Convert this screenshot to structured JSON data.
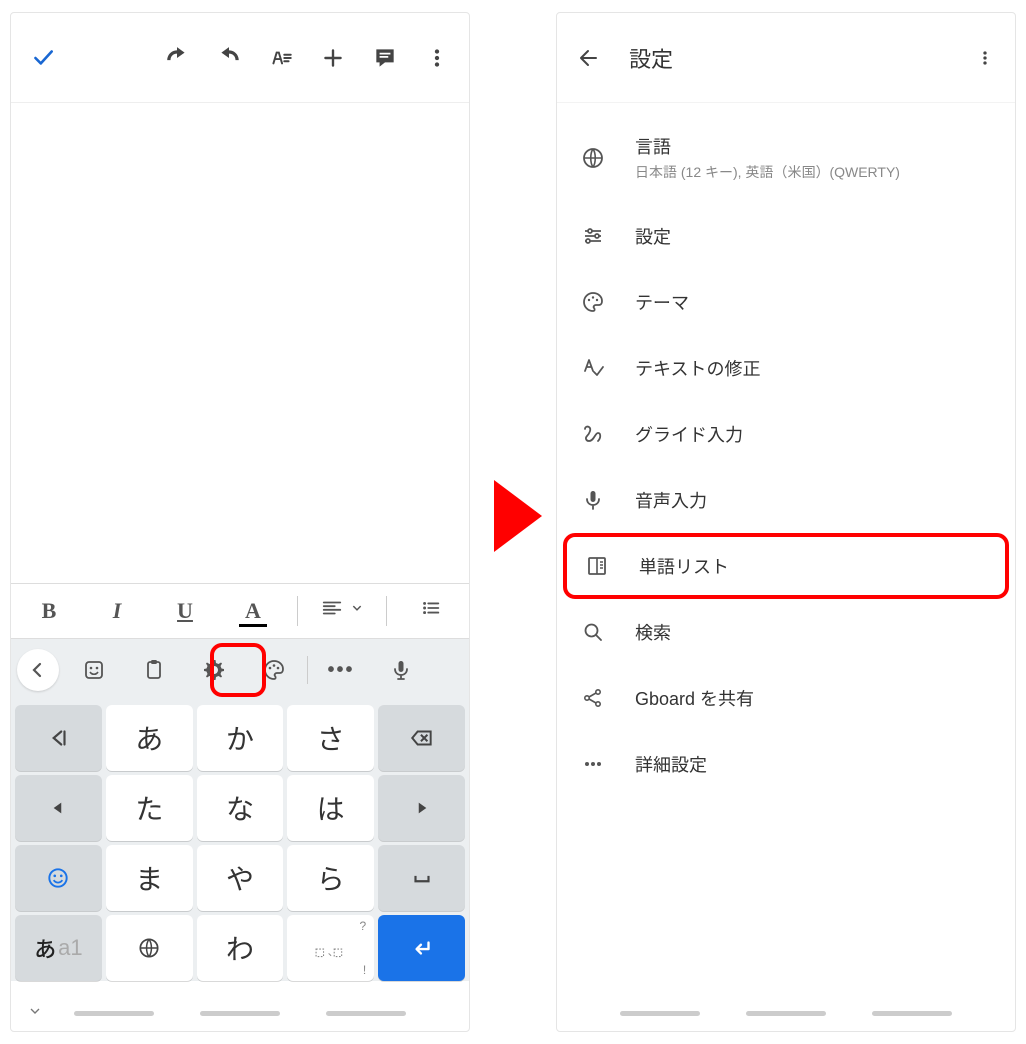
{
  "left": {
    "toolbar": {
      "check": "check-icon",
      "undo": "undo-icon",
      "redo": "redo-icon",
      "text_format": "text-format-icon",
      "add": "plus-icon",
      "comment": "comment-icon",
      "more": "more-vert-icon"
    },
    "format_bar": {
      "bold": "B",
      "italic": "I",
      "underline": "U",
      "color": "A"
    },
    "kbd_toolrow": {
      "back": "‹",
      "sticker": "sticker-icon",
      "clipboard": "clipboard-icon",
      "gear": "gear-icon",
      "palette": "palette-icon",
      "more": "•••",
      "mic": "mic-icon"
    },
    "keys": {
      "r1": [
        "あ",
        "か",
        "さ"
      ],
      "r2": [
        "た",
        "な",
        "は"
      ],
      "r3": [
        "ま",
        "や",
        "ら"
      ],
      "r4_wa": "わ",
      "r4_punct_sup": "?",
      "r4_punct_sub": "!",
      "mode_jp": "あ",
      "mode_en": "a1"
    }
  },
  "right": {
    "title": "設定",
    "items": {
      "lang_label": "言語",
      "lang_sub": "日本語 (12 キー), 英語（米国）(QWERTY)",
      "prefs": "設定",
      "theme": "テーマ",
      "textcorr": "テキストの修正",
      "glide": "グライド入力",
      "voice": "音声入力",
      "wordlist": "単語リスト",
      "search": "検索",
      "share": "Gboard を共有",
      "advanced": "詳細設定"
    }
  }
}
